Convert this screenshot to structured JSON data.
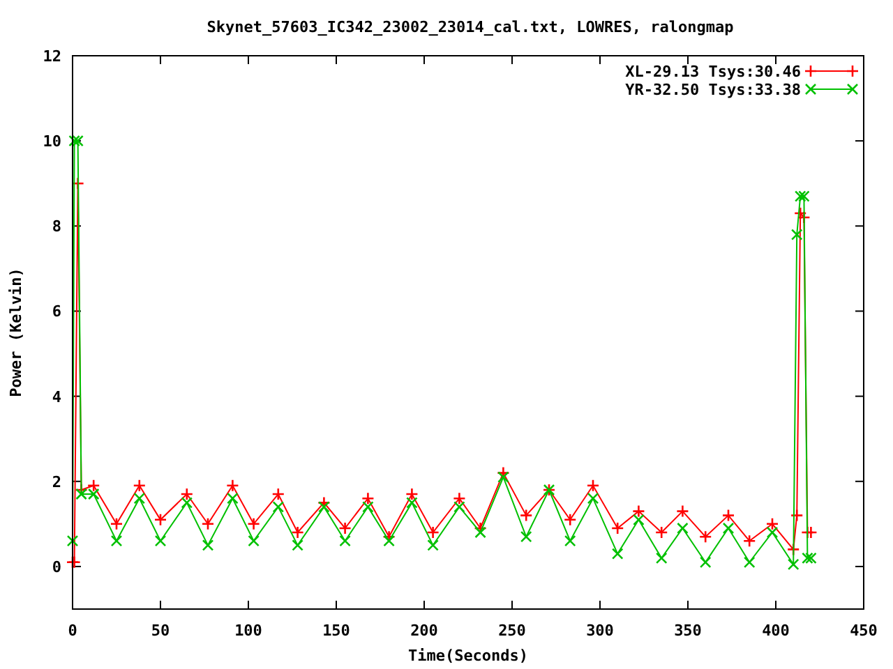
{
  "chart_data": {
    "type": "line",
    "title": "Skynet_57603_IC342_23002_23014_cal.txt, LOWRES, ralongmap",
    "xlabel": "Time(Seconds)",
    "ylabel": "Power (Kelvin)",
    "x": [
      0,
      1,
      3,
      5,
      12,
      25,
      38,
      50,
      65,
      77,
      91,
      103,
      117,
      128,
      143,
      155,
      168,
      180,
      193,
      205,
      220,
      232,
      245,
      258,
      271,
      283,
      296,
      310,
      322,
      335,
      347,
      360,
      373,
      385,
      398,
      410,
      412,
      414,
      416,
      418,
      420
    ],
    "series": [
      {
        "name": "XL-29.13 Tsys:30.46",
        "color": "#ff0000",
        "values": [
          0.1,
          0.1,
          9.0,
          1.8,
          1.9,
          1.0,
          1.9,
          1.1,
          1.7,
          1.0,
          1.9,
          1.0,
          1.7,
          0.8,
          1.5,
          0.9,
          1.6,
          0.7,
          1.7,
          0.8,
          1.6,
          0.9,
          2.2,
          1.2,
          1.8,
          1.1,
          1.9,
          0.9,
          1.3,
          0.8,
          1.3,
          0.7,
          1.2,
          0.6,
          1.0,
          0.4,
          1.2,
          8.3,
          8.2,
          0.8,
          0.8
        ]
      },
      {
        "name": "YR-32.50 Tsys:33.38",
        "color": "#00c000",
        "values": [
          0.6,
          10.0,
          10.0,
          1.7,
          1.7,
          0.6,
          1.6,
          0.6,
          1.5,
          0.5,
          1.6,
          0.6,
          1.4,
          0.5,
          1.4,
          0.6,
          1.4,
          0.6,
          1.5,
          0.5,
          1.4,
          0.8,
          2.1,
          0.7,
          1.8,
          0.6,
          1.6,
          0.3,
          1.1,
          0.2,
          0.9,
          0.1,
          0.9,
          0.1,
          0.8,
          0.05,
          7.8,
          8.7,
          8.7,
          0.2,
          0.2
        ]
      }
    ],
    "xlim": [
      0,
      450
    ],
    "ylim": [
      -1,
      12
    ],
    "xticks": [
      0,
      50,
      100,
      150,
      200,
      250,
      300,
      350,
      400,
      450
    ],
    "yticks": [
      0,
      2,
      4,
      6,
      8,
      10,
      12
    ],
    "legend": true
  }
}
